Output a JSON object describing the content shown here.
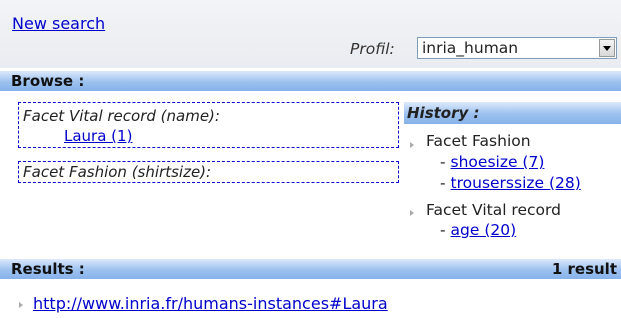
{
  "top": {
    "new_search": "New search",
    "profile_label": "Profil:",
    "profile_value": "inria_human"
  },
  "browse": {
    "title": "Browse :",
    "facets": [
      {
        "title": "Facet  Vital record (name):",
        "items": [
          "Laura (1)"
        ]
      },
      {
        "title": "Facet  Fashion (shirtsize):",
        "items": []
      }
    ]
  },
  "history": {
    "title": "History :",
    "groups": [
      {
        "label": "Facet Fashion",
        "items": [
          "shoesize (7)",
          "trouserssize (28)"
        ]
      },
      {
        "label": "Facet Vital record",
        "items": [
          "age (20)"
        ]
      }
    ]
  },
  "results": {
    "title": "Results :",
    "count": "1 result",
    "items": [
      "http://www.inria.fr/humans-instances#Laura"
    ]
  }
}
